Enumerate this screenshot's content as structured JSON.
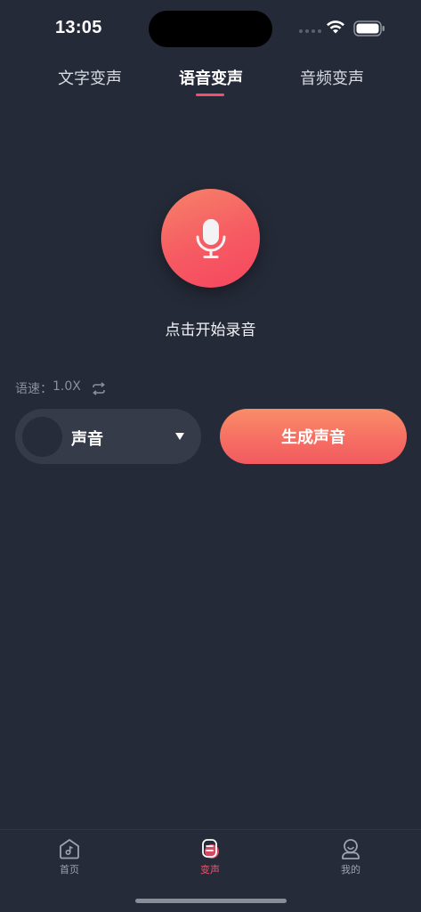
{
  "status_bar": {
    "time": "13:05"
  },
  "tabs": [
    {
      "label": "文字变声",
      "active": false
    },
    {
      "label": "语音变声",
      "active": true
    },
    {
      "label": "音频变声",
      "active": false
    }
  ],
  "recorder": {
    "icon": "microphone-icon",
    "prompt": "点击开始录音"
  },
  "speed": {
    "label": "语速：",
    "value": "1.0X",
    "icon": "repeat-icon"
  },
  "voice_select": {
    "label": "声音",
    "icon": "caret-down-icon"
  },
  "generate_button": {
    "label": "生成声音"
  },
  "bottom_nav": [
    {
      "label": "首页",
      "icon": "home-music-icon",
      "active": false
    },
    {
      "label": "变声",
      "icon": "voice-change-icon",
      "active": true
    },
    {
      "label": "我的",
      "icon": "profile-icon",
      "active": false
    }
  ],
  "colors": {
    "background": "#252a38",
    "accent": "#f2516a",
    "gradient_start": "#f98d68",
    "gradient_end": "#f25a5f"
  }
}
